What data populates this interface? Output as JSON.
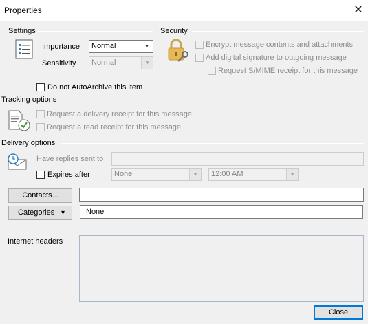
{
  "window": {
    "title": "Properties",
    "close_glyph": "✕"
  },
  "settings": {
    "title": "Settings",
    "importance_label": "Importance",
    "importance_value": "Normal",
    "sensitivity_label": "Sensitivity",
    "sensitivity_value": "Normal",
    "autoarchive_label": "Do not AutoArchive this item"
  },
  "security": {
    "title": "Security",
    "encrypt_label": "Encrypt message contents and attachments",
    "signature_label": "Add digital signature to outgoing message",
    "smime_label": "Request S/MIME receipt for this message"
  },
  "tracking": {
    "title": "Tracking options",
    "delivery_receipt_label": "Request a delivery receipt for this message",
    "read_receipt_label": "Request a read receipt for this message"
  },
  "delivery": {
    "title": "Delivery options",
    "replies_label": "Have replies sent to",
    "expires_label": "Expires after",
    "expires_date": "None",
    "expires_time": "12:00 AM"
  },
  "contacts_button": "Contacts...",
  "categories_button": "Categories",
  "categories_value": "None",
  "internet_headers_label": "Internet headers",
  "close_button": "Close",
  "icons": {
    "dropdown": "▾"
  }
}
